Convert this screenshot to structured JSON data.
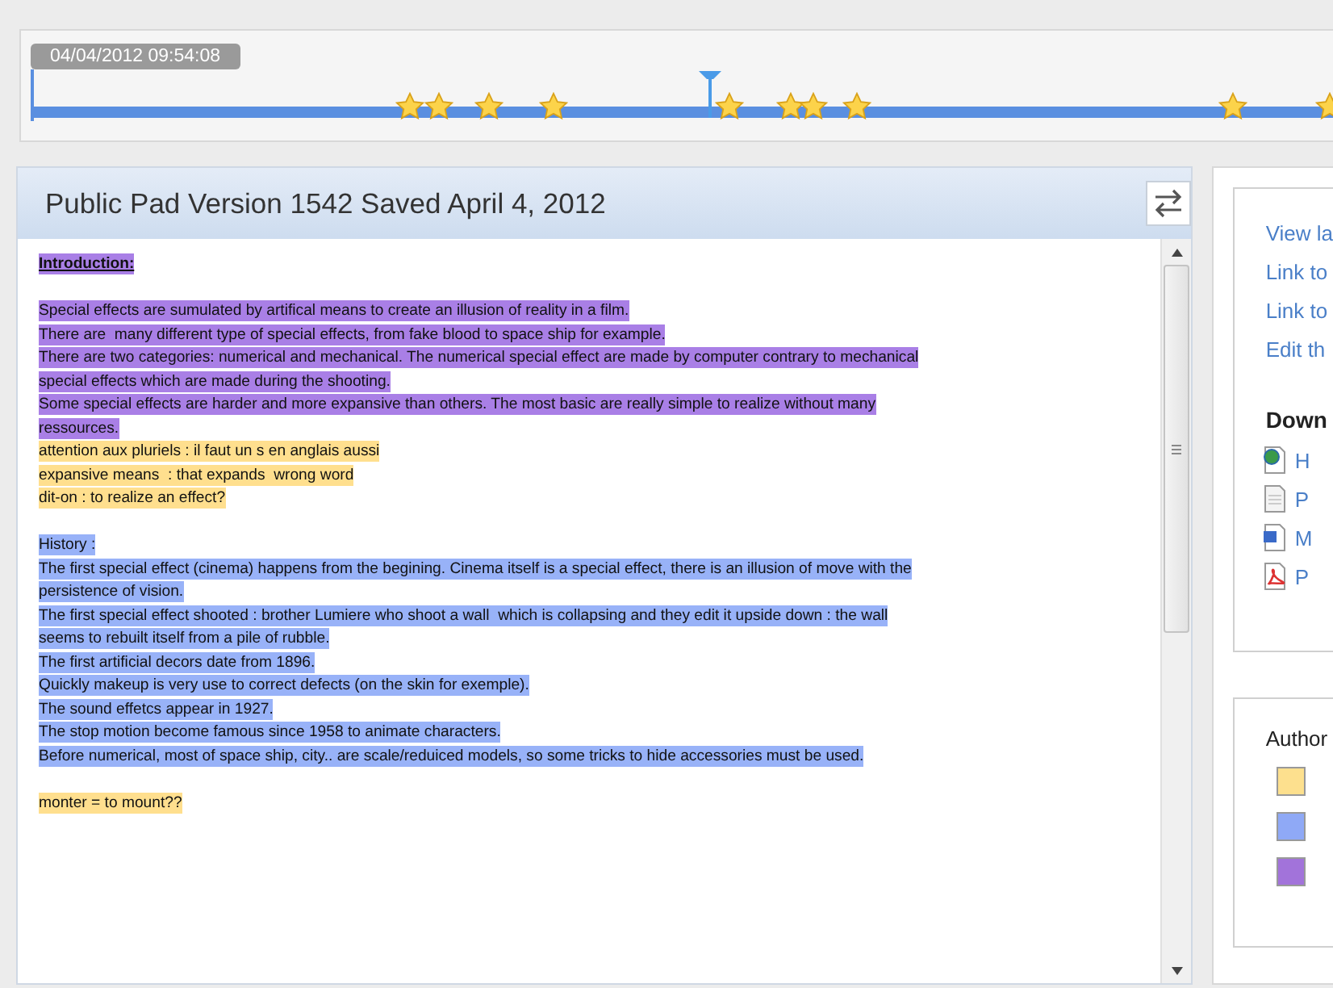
{
  "timeline": {
    "timestamp": "04/04/2012 09:54:08",
    "level": 0.52
  },
  "pad": {
    "title": "Public Pad Version 1542 Saved April 4, 2012",
    "paragraphs": [
      {
        "text": "Introduction:",
        "color": "#a97fe6",
        "kind": "heading"
      },
      {
        "kind": "blank"
      },
      {
        "text": "Special effects are sumulated by artifical means to create an illusion of reality in a film.",
        "color": "#a97fe6",
        "kind": "line"
      },
      {
        "text": "There are  many different type of special effects, from fake blood to space ship for example.",
        "color": "#a97fe6",
        "kind": "line"
      },
      {
        "text": "There are two categories: numerical and mechanical. The numerical special effect are made by computer contrary to mechanical",
        "color": "#a97fe6",
        "kind": "line"
      },
      {
        "text": "special effects which are made during the shooting.",
        "color": "#a97fe6",
        "kind": "line"
      },
      {
        "text": "Some special effects are harder and more expansive than others. The most basic are really simple to realize without many",
        "color": "#a97fe6",
        "kind": "line"
      },
      {
        "text": "ressources.",
        "color": "#a97fe6",
        "kind": "line"
      },
      {
        "text": "attention aux pluriels : il faut un s en anglais aussi",
        "color": "#ffdf8e",
        "kind": "line"
      },
      {
        "text": "expansive means  : that expands  wrong word",
        "color": "#ffdf8e",
        "kind": "line"
      },
      {
        "text": "dit-on : to realize an effect?",
        "color": "#ffdf8e",
        "kind": "line"
      },
      {
        "kind": "blank"
      },
      {
        "text": "History :",
        "color": "#98b2f8",
        "kind": "line"
      },
      {
        "text": "The first special effect (cinema) happens from the begining. Cinema itself is a special effect, there is an illusion of move with the",
        "color": "#98b2f8",
        "kind": "line"
      },
      {
        "text": "persistence of vision.",
        "color": "#98b2f8",
        "kind": "line"
      },
      {
        "text": "The first special effect shooted : brother Lumiere who shoot a wall  which is collapsing and they edit it upside down : the wall",
        "color": "#98b2f8",
        "kind": "line"
      },
      {
        "text": "seems to rebuilt itself from a pile of rubble.",
        "color": "#98b2f8",
        "kind": "line"
      },
      {
        "text": "The first artificial decors date from 1896.",
        "color": "#98b2f8",
        "kind": "line"
      },
      {
        "text": "Quickly makeup is very use to correct defects (on the skin for exemple).",
        "color": "#98b2f8",
        "kind": "line"
      },
      {
        "text": "The sound effetcs appear in 1927.",
        "color": "#98b2f8",
        "kind": "line"
      },
      {
        "text": "The stop motion become famous since 1958 to animate characters.",
        "color": "#98b2f8",
        "kind": "line"
      },
      {
        "text": "Before numerical, most of space ship, city.. are scale/reduiced models, so some tricks to hide accessories must be used.",
        "color": "#98b2f8",
        "kind": "line"
      },
      {
        "kind": "blank"
      },
      {
        "text": "monter = to mount??",
        "color": "#ffdf8e",
        "kind": "line"
      }
    ]
  },
  "sidebar": {
    "links": [
      "View la",
      "Link to",
      "Link to",
      "Edit th"
    ],
    "downloads_title": "Down",
    "downloads": [
      {
        "kind": "web",
        "label": "H"
      },
      {
        "kind": "text",
        "label": "P"
      },
      {
        "kind": "word",
        "label": "M"
      },
      {
        "kind": "pdf",
        "label": "P"
      }
    ],
    "authors_title": "Author",
    "authors": [
      {
        "color": "#fde08e"
      },
      {
        "color": "#8fa9f6"
      },
      {
        "color": "#a273da"
      }
    ]
  }
}
